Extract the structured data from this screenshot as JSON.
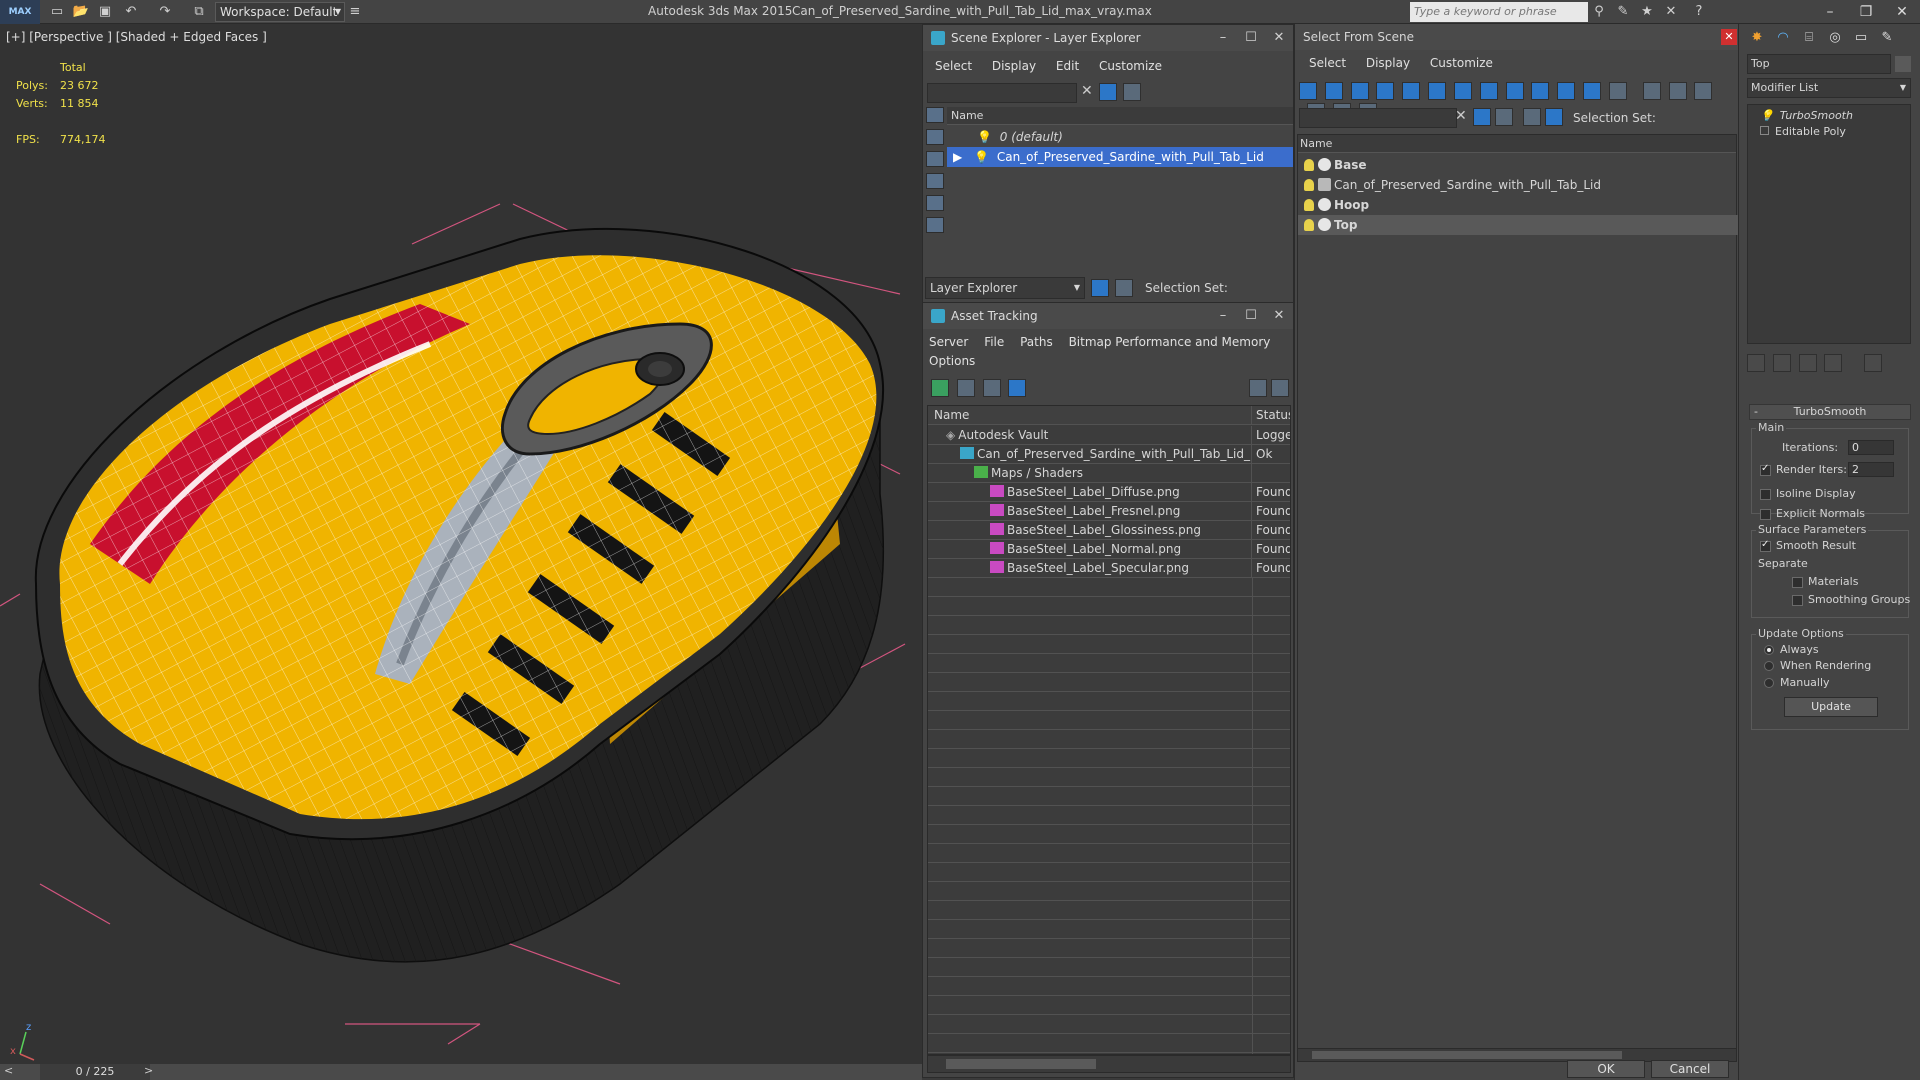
{
  "titlebar": {
    "logo": "MAX",
    "workspace": "Workspace: Default",
    "app_name": "Autodesk 3ds Max  2015",
    "file_name": "Can_of_Preserved_Sardine_with_Pull_Tab_Lid_max_vray.max",
    "search_placeholder": "Type a keyword or phrase"
  },
  "viewport": {
    "label": "[+] [Perspective ] [Shaded + Edged Faces ]",
    "stats_header": "Total",
    "polys_label": "Polys:",
    "polys_value": "23 672",
    "verts_label": "Verts:",
    "verts_value": "11 854",
    "fps_label": "FPS:",
    "fps_value": "774,174",
    "axis_x": "x",
    "axis_z": "z"
  },
  "timeline": {
    "frame": "0 / 225"
  },
  "scene_explorer": {
    "title": "Scene Explorer - Layer Explorer",
    "menu": [
      "Select",
      "Display",
      "Edit",
      "Customize"
    ],
    "column_name": "Name",
    "rows": [
      "0 (default)",
      "Can_of_Preserved_Sardine_with_Pull_Tab_Lid"
    ],
    "footer_dropdown": "Layer Explorer",
    "selection_set": "Selection Set:"
  },
  "asset_tracking": {
    "title": "Asset Tracking",
    "menu": [
      "Server",
      "File",
      "Paths",
      "Bitmap Performance and Memory"
    ],
    "menu2": "Options",
    "col_name": "Name",
    "col_status": "Status",
    "rows": [
      {
        "name": "Autodesk Vault",
        "status": "Logged"
      },
      {
        "name": "Can_of_Preserved_Sardine_with_Pull_Tab_Lid_ma...",
        "status": "Ok"
      },
      {
        "name": "Maps / Shaders",
        "status": ""
      },
      {
        "name": "BaseSteel_Label_Diffuse.png",
        "status": "Found"
      },
      {
        "name": "BaseSteel_Label_Fresnel.png",
        "status": "Found"
      },
      {
        "name": "BaseSteel_Label_Glossiness.png",
        "status": "Found"
      },
      {
        "name": "BaseSteel_Label_Normal.png",
        "status": "Found"
      },
      {
        "name": "BaseSteel_Label_Specular.png",
        "status": "Found"
      }
    ]
  },
  "select_from_scene": {
    "title": "Select From Scene",
    "menu": [
      "Select",
      "Display",
      "Customize"
    ],
    "selection_set": "Selection Set:",
    "column_name": "Name",
    "rows": [
      "Base",
      "Can_of_Preserved_Sardine_with_Pull_Tab_Lid",
      "Hoop",
      "Top"
    ],
    "ok": "OK",
    "cancel": "Cancel"
  },
  "command_panel": {
    "object_name": "Top",
    "modifier_list": "Modifier List",
    "stack": [
      "TurboSmooth",
      "Editable Poly"
    ],
    "rollout": "TurboSmooth",
    "main_label": "Main",
    "iterations_label": "Iterations:",
    "iterations_value": "0",
    "render_iters_label": "Render Iters:",
    "render_iters_value": "2",
    "isoline": "Isoline Display",
    "explicit_normals": "Explicit Normals",
    "surface_params": "Surface Parameters",
    "smooth_result": "Smooth Result",
    "separate": "Separate",
    "materials": "Materials",
    "smoothing_groups": "Smoothing Groups",
    "update_options": "Update Options",
    "always": "Always",
    "when_rendering": "When Rendering",
    "manually": "Manually",
    "update_btn": "Update"
  },
  "colors": {
    "selection_blue": "#3b6dcc",
    "can_yellow": "#f0b400",
    "stats_yellow": "#f0e14a",
    "bbox_pink": "#e0608a"
  }
}
